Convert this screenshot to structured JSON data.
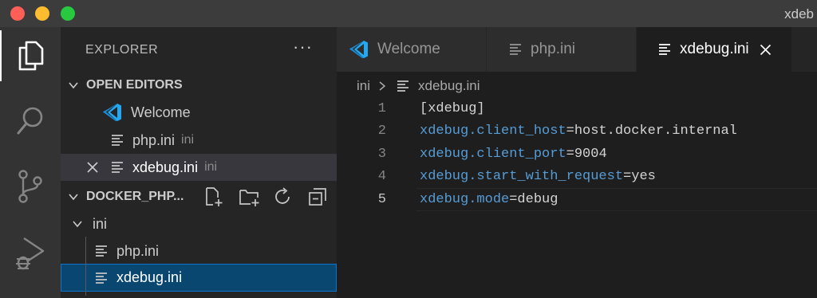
{
  "window": {
    "title": "xdeb"
  },
  "activity_bar": {
    "items": [
      "explorer-icon",
      "search-icon",
      "source-control-icon",
      "run-debug-icon"
    ]
  },
  "sidebar": {
    "header": "EXPLORER",
    "more": "···",
    "open_editors": {
      "title": "OPEN EDITORS",
      "items": [
        {
          "name": "Welcome",
          "dir": ""
        },
        {
          "name": "php.ini",
          "dir": "ini"
        },
        {
          "name": "xdebug.ini",
          "dir": "ini"
        }
      ]
    },
    "folder": {
      "title": "DOCKER_PHP...",
      "tree": [
        {
          "name": "ini"
        },
        {
          "name": "php.ini"
        },
        {
          "name": "xdebug.ini"
        }
      ]
    }
  },
  "tabs": [
    {
      "label": "Welcome"
    },
    {
      "label": "php.ini"
    },
    {
      "label": "xdebug.ini"
    }
  ],
  "breadcrumb": {
    "folder": "ini",
    "file": "xdebug.ini"
  },
  "code": {
    "lines": [
      {
        "num": "1",
        "key": "",
        "rest": "[xdebug]"
      },
      {
        "num": "2",
        "key": "xdebug.client_host",
        "rest": "=host.docker.internal"
      },
      {
        "num": "3",
        "key": "xdebug.client_port",
        "rest": "=9004"
      },
      {
        "num": "4",
        "key": "xdebug.start_with_request",
        "rest": "=yes"
      },
      {
        "num": "5",
        "key": "xdebug.mode",
        "rest": "=debug"
      }
    ]
  },
  "colors": {
    "accent": "#0e73cc",
    "key": "#569cd6",
    "vscode_blue": "#23a9f2"
  }
}
